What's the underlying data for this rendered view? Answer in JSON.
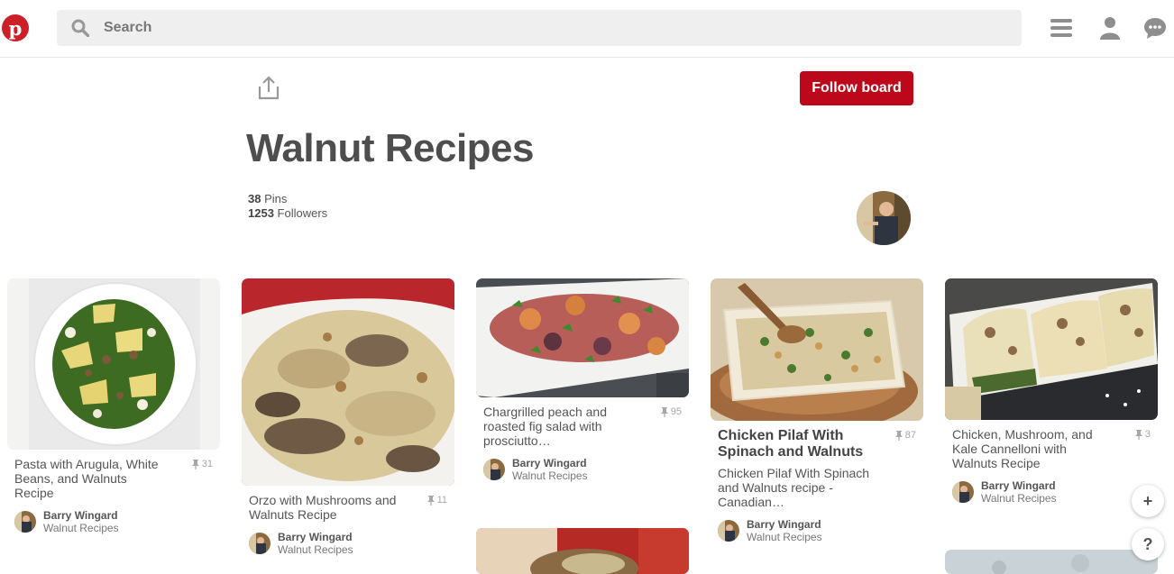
{
  "header": {
    "logo_letter": "p",
    "search_placeholder": "Search",
    "icons": [
      "menu-icon",
      "profile-icon",
      "messages-icon"
    ]
  },
  "board": {
    "title": "Walnut Recipes",
    "pins_count": "38",
    "pins_label": "Pins",
    "followers_count": "1253",
    "followers_label": "Followers",
    "follow_label": "Follow board",
    "accent_color": "#bd081c"
  },
  "pins": [
    {
      "description": "Pasta with Arugula, White Beans, and Walnuts Recipe",
      "repins": "31",
      "pinner": "Barry Wingard",
      "board": "Walnut Recipes"
    },
    {
      "description": "Orzo with Mushrooms and Walnuts Recipe",
      "repins": "11",
      "pinner": "Barry Wingard",
      "board": "Walnut Recipes"
    },
    {
      "description": "Chargrilled peach and roasted fig salad with prosciutto…",
      "repins": "95",
      "pinner": "Barry Wingard",
      "board": "Walnut Recipes"
    },
    {
      "title": "Chicken Pilaf With Spinach and Walnuts",
      "description": "Chicken Pilaf With Spinach and Walnuts recipe - Canadian…",
      "repins": "87",
      "pinner": "Barry Wingard",
      "board": "Walnut Recipes"
    },
    {
      "description": "Chicken, Mushroom, and Kale Cannelloni with Walnuts Recipe",
      "repins": "3",
      "pinner": "Barry Wingard",
      "board": "Walnut Recipes"
    }
  ],
  "fabs": {
    "add": "+",
    "help": "?"
  }
}
